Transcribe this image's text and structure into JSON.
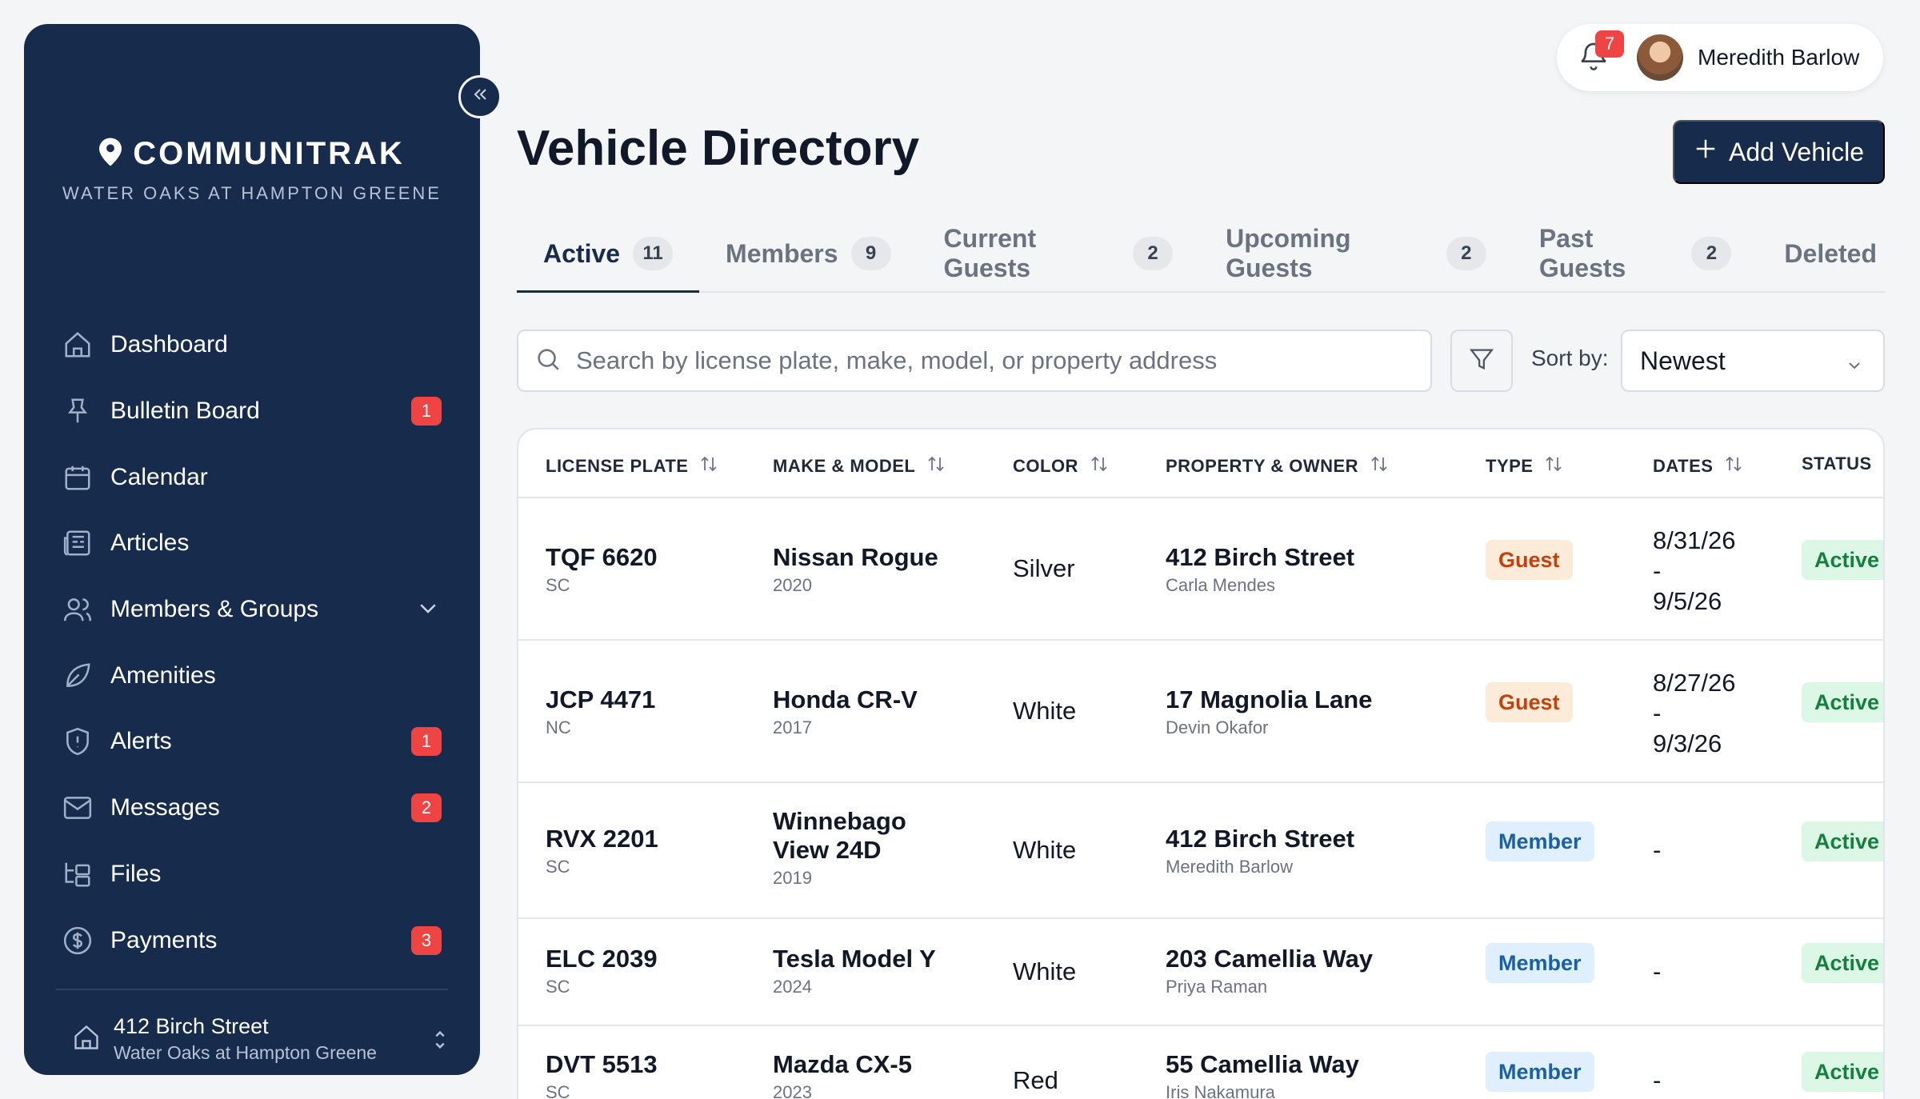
{
  "sidebar": {
    "brand_name": "COMMUNITRAK",
    "brand_sub": "WATER OAKS AT HAMPTON GREENE",
    "items": [
      {
        "label": "Dashboard",
        "icon": "home-icon"
      },
      {
        "label": "Bulletin Board",
        "icon": "pin-icon",
        "badge": "1"
      },
      {
        "label": "Calendar",
        "icon": "calendar-icon"
      },
      {
        "label": "Articles",
        "icon": "newspaper-icon"
      },
      {
        "label": "Members & Groups",
        "icon": "users-icon"
      },
      {
        "label": "Amenities",
        "icon": "leaf-icon"
      },
      {
        "label": "Alerts",
        "icon": "shield-alert-icon",
        "badge": "1"
      },
      {
        "label": "Messages",
        "icon": "mail-icon",
        "badge": "2"
      },
      {
        "label": "Files",
        "icon": "folder-tree-icon"
      },
      {
        "label": "Payments",
        "icon": "dollar-circle-icon",
        "badge": "3"
      }
    ],
    "property": {
      "address": "412 Birch Street",
      "community": "Water Oaks at Hampton Greene"
    }
  },
  "header": {
    "notification_count": "7",
    "user_name": "Meredith Barlow",
    "title": "Vehicle Directory",
    "add_label": "Add Vehicle"
  },
  "tabs": [
    {
      "label": "Active",
      "count": "11"
    },
    {
      "label": "Members",
      "count": "9"
    },
    {
      "label": "Current Guests",
      "count": "2"
    },
    {
      "label": "Upcoming Guests",
      "count": "2"
    },
    {
      "label": "Past Guests",
      "count": "2"
    },
    {
      "label": "Deleted",
      "count": ""
    }
  ],
  "search": {
    "placeholder": "Search by license plate, make, model, or property address"
  },
  "sort": {
    "label": "Sort by:",
    "value": "Newest"
  },
  "table": {
    "columns": [
      "LICENSE PLATE",
      "MAKE & MODEL",
      "COLOR",
      "PROPERTY & OWNER",
      "TYPE",
      "DATES",
      "STATUS"
    ],
    "rows": [
      {
        "plate": "TQF 6620",
        "state": "SC",
        "model": "Nissan Rogue",
        "year": "2020",
        "color": "Silver",
        "address": "412 Birch Street",
        "owner": "Carla Mendes",
        "type": "Guest",
        "date_start": "8/31/26",
        "date_sep": "-",
        "date_end": "9/5/26",
        "status": "Active"
      },
      {
        "plate": "JCP 4471",
        "state": "NC",
        "model": "Honda CR-V",
        "year": "2017",
        "color": "White",
        "address": "17 Magnolia Lane",
        "owner": "Devin Okafor",
        "type": "Guest",
        "date_start": "8/27/26",
        "date_sep": "-",
        "date_end": "9/3/26",
        "status": "Active"
      },
      {
        "plate": "RVX 2201",
        "state": "SC",
        "model": "Winnebago View 24D",
        "year": "2019",
        "color": "White",
        "address": "412 Birch Street",
        "owner": "Meredith Barlow",
        "type": "Member",
        "date_start": "-",
        "status": "Active"
      },
      {
        "plate": "ELC 2039",
        "state": "SC",
        "model": "Tesla Model Y",
        "year": "2024",
        "color": "White",
        "address": "203 Camellia Way",
        "owner": "Priya Raman",
        "type": "Member",
        "date_start": "-",
        "status": "Active"
      },
      {
        "plate": "DVT 5513",
        "state": "SC",
        "model": "Mazda CX-5",
        "year": "2023",
        "color": "Red",
        "address": "55 Camellia Way",
        "owner": "Iris Nakamura",
        "type": "Member",
        "date_start": "-",
        "status": "Active"
      }
    ]
  }
}
